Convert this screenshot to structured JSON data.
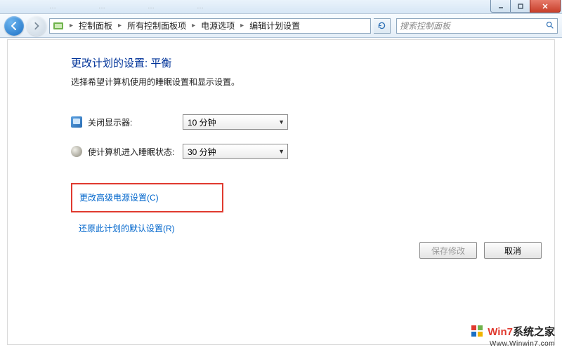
{
  "titlebar": {
    "tab_hints": [
      "",
      "",
      "",
      "",
      ""
    ]
  },
  "nav": {
    "breadcrumb": [
      "控制面板",
      "所有控制面板项",
      "电源选项",
      "编辑计划设置"
    ],
    "search_placeholder": "搜索控制面板"
  },
  "page": {
    "heading": "更改计划的设置: 平衡",
    "description": "选择希望计算机使用的睡眠设置和显示设置。",
    "rows": [
      {
        "label": "关闭显示器:",
        "value": "10 分钟"
      },
      {
        "label": "使计算机进入睡眠状态:",
        "value": "30 分钟"
      }
    ],
    "link_advanced": "更改高级电源设置(C)",
    "link_restore": "还原此计划的默认设置(R)",
    "buttons": {
      "save": "保存修改",
      "cancel": "取消"
    }
  },
  "watermark": {
    "brand_red": "Win7",
    "brand_black": "系统之家",
    "url": "Www.Winwin7.com"
  }
}
